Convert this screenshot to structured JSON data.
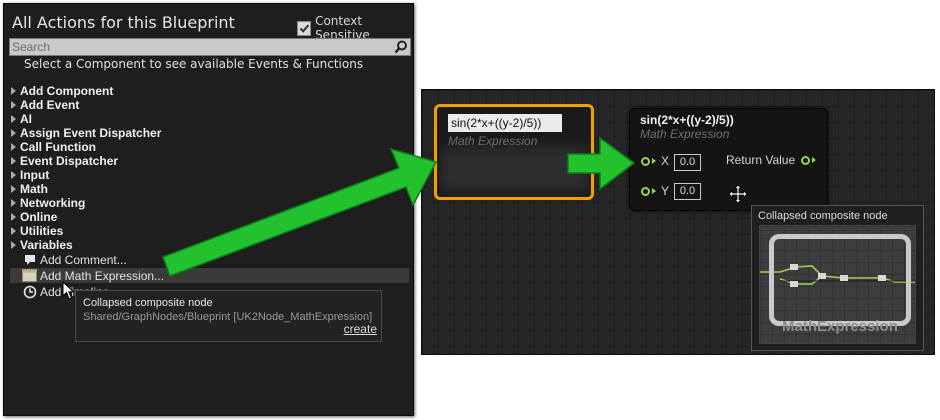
{
  "menu": {
    "title": "All Actions for this Blueprint",
    "context_sensitive_label": "Context Sensitive",
    "context_sensitive_checked": true,
    "search_placeholder": "Search",
    "hint": "Select a Component to see available Events & Functions",
    "categories": [
      "Add Component",
      "Add Event",
      "AI",
      "Assign Event Dispatcher",
      "Call Function",
      "Event Dispatcher",
      "Input",
      "Math",
      "Networking",
      "Online",
      "Utilities",
      "Variables"
    ],
    "actions": [
      {
        "label": "Add Comment...",
        "icon": "comment-icon"
      },
      {
        "label": "Add Math Expression...",
        "icon": "math-expression-icon",
        "selected": true
      },
      {
        "label": "Add Timeline...",
        "icon": "timeline-clock-icon"
      }
    ]
  },
  "tooltip": {
    "title": "Collapsed composite node",
    "path": "Shared/GraphNodes/Blueprint [UK2Node_MathExpression]",
    "link": "create"
  },
  "graph": {
    "editing_node": {
      "expression": "sin(2*x+((y-2)/5))",
      "subtitle": "Math Expression",
      "border_color": "#f0a100"
    },
    "result_node": {
      "title": "sin(2*x+((y-2)/5))",
      "subtitle": "Math Expression",
      "inputs": [
        {
          "name": "X",
          "value": "0.0"
        },
        {
          "name": "Y",
          "value": "0.0"
        }
      ],
      "output": "Return Value",
      "pin_color": "#9cd24c"
    },
    "preview_popup": {
      "title": "Collapsed composite node",
      "watermark": "MathExpression"
    }
  },
  "arrow_color": "#1fbf2a"
}
